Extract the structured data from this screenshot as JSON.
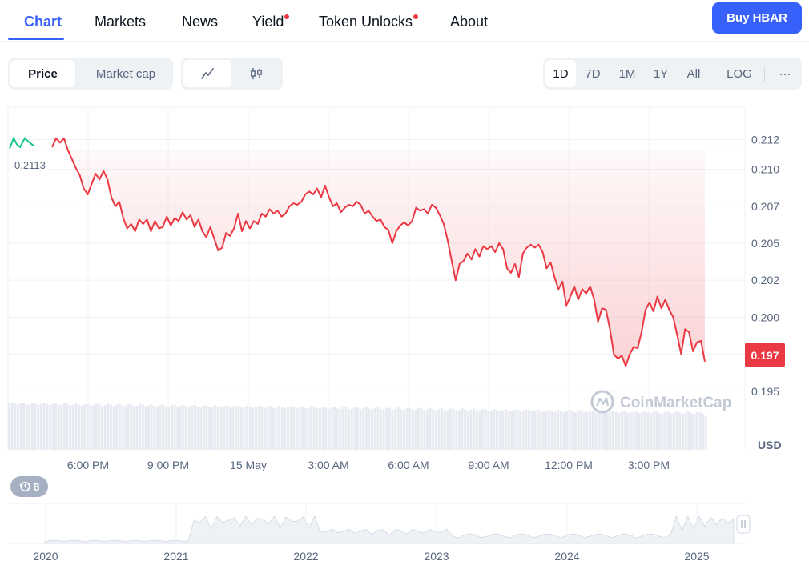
{
  "tabs": [
    {
      "label": "Chart",
      "active": true,
      "dot": false
    },
    {
      "label": "Markets",
      "active": false,
      "dot": false
    },
    {
      "label": "News",
      "active": false,
      "dot": false
    },
    {
      "label": "Yield",
      "active": false,
      "dot": true
    },
    {
      "label": "Token Unlocks",
      "active": false,
      "dot": true
    },
    {
      "label": "About",
      "active": false,
      "dot": false
    }
  ],
  "buy_button": "Buy HBAR",
  "toolbar": {
    "metric_tabs": [
      "Price",
      "Market cap"
    ],
    "chart_types": [
      "line-chart-icon",
      "candlestick-icon"
    ],
    "ranges": [
      "1D",
      "7D",
      "1M",
      "1Y",
      "All"
    ],
    "log_label": "LOG",
    "more_label": "···"
  },
  "colors": {
    "accent": "#3861fb",
    "down": "#ea3943",
    "up": "#16c784"
  },
  "watermark": "CoinMarketCap",
  "history_badge": {
    "icon": "history-icon",
    "count": "8"
  },
  "chart_data": {
    "type": "line",
    "unit_label": "USD",
    "reference_value": 0.2113,
    "reference_label": "0.2113",
    "current_value": 0.197,
    "current_label": "0.197",
    "y_ticks": [
      0.212,
      0.21,
      0.2075,
      0.205,
      0.2025,
      0.2,
      0.1975,
      0.195
    ],
    "y_tick_labels": [
      "0.212",
      "0.210",
      "0.207",
      "0.205",
      "0.202",
      "0.200",
      "",
      "0.195"
    ],
    "ylim": [
      0.1945,
      0.2142
    ],
    "x_tick_labels": [
      "6:00 PM",
      "9:00 PM",
      "15 May",
      "3:00 AM",
      "6:00 AM",
      "9:00 AM",
      "12:00 PM",
      "3:00 PM"
    ],
    "x_tick_hours": [
      3,
      6,
      9,
      12,
      15,
      18,
      21,
      24
    ],
    "x_range_hours": [
      0,
      27.6
    ],
    "grid": true,
    "series": [
      {
        "values": [
          0.2115,
          0.2121,
          0.2118,
          0.2121,
          0.2113,
          0.2107,
          0.2101,
          0.2096,
          0.2087,
          0.2083,
          0.209,
          0.2097,
          0.2093,
          0.2099,
          0.2093,
          0.2081,
          0.2075,
          0.2078,
          0.2067,
          0.206,
          0.2063,
          0.2058,
          0.2066,
          0.2063,
          0.2066,
          0.2058,
          0.2065,
          0.206,
          0.2061,
          0.2068,
          0.2062,
          0.2067,
          0.2065,
          0.2071,
          0.2066,
          0.2069,
          0.2061,
          0.2066,
          0.2058,
          0.2054,
          0.2061,
          0.2053,
          0.2045,
          0.2047,
          0.2057,
          0.2055,
          0.206,
          0.207,
          0.2058,
          0.2065,
          0.206,
          0.2065,
          0.2063,
          0.207,
          0.2068,
          0.2073,
          0.207,
          0.2072,
          0.2068,
          0.207,
          0.2075,
          0.2077,
          0.2076,
          0.2078,
          0.2083,
          0.2085,
          0.2083,
          0.2087,
          0.2081,
          0.2089,
          0.2081,
          0.2075,
          0.2077,
          0.2071,
          0.2074,
          0.2076,
          0.2075,
          0.2078,
          0.2076,
          0.207,
          0.2072,
          0.2068,
          0.2065,
          0.2066,
          0.2061,
          0.2059,
          0.205,
          0.2058,
          0.2062,
          0.2064,
          0.2062,
          0.2065,
          0.2074,
          0.2072,
          0.2073,
          0.207,
          0.2076,
          0.2074,
          0.2069,
          0.2063,
          0.2052,
          0.2038,
          0.2025,
          0.2036,
          0.2038,
          0.2043,
          0.2039,
          0.2046,
          0.2041,
          0.2048,
          0.2046,
          0.2048,
          0.2044,
          0.205,
          0.2046,
          0.2033,
          0.203,
          0.2036,
          0.2027,
          0.2043,
          0.2047,
          0.2049,
          0.2047,
          0.2049,
          0.2044,
          0.2033,
          0.2037,
          0.2027,
          0.2019,
          0.2024,
          0.2008,
          0.2014,
          0.2021,
          0.2012,
          0.2019,
          0.2016,
          0.2021,
          0.2012,
          0.1997,
          0.2006,
          0.2005,
          0.1992,
          0.1975,
          0.1972,
          0.1974,
          0.1967,
          0.1975,
          0.198,
          0.1979,
          0.199,
          0.2005,
          0.201,
          0.2004,
          0.2014,
          0.2006,
          0.2012,
          0.2005,
          0.2,
          0.1988,
          0.1975,
          0.1992,
          0.199,
          0.1977,
          0.1983,
          0.1984,
          0.197
        ],
        "color": "#ea3943"
      }
    ],
    "volume_bar_count": 240
  },
  "navigator": {
    "x_labels": [
      "2020",
      "2021",
      "2022",
      "2023",
      "2024",
      "2025"
    ],
    "handle_icon": "drag-handle-icon"
  }
}
